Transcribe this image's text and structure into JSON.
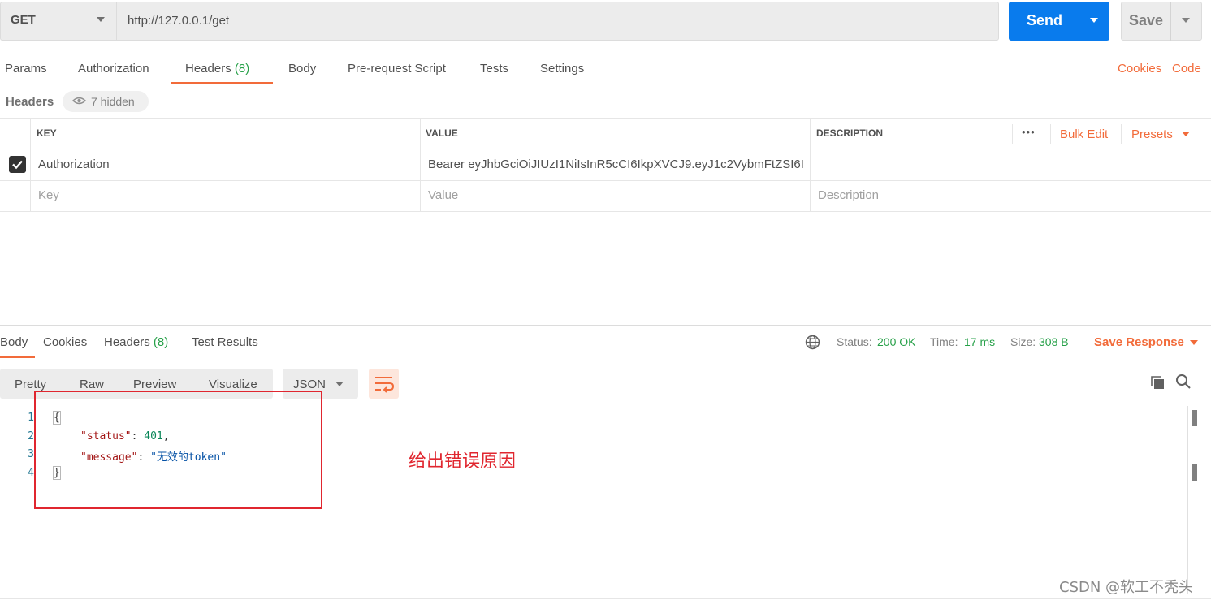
{
  "request": {
    "method": "GET",
    "url": "http://127.0.0.1/get",
    "send_label": "Send",
    "save_label": "Save"
  },
  "request_tabs": [
    {
      "label": "Params"
    },
    {
      "label": "Authorization"
    },
    {
      "label": "Headers",
      "count": "(8)",
      "active": true
    },
    {
      "label": "Body"
    },
    {
      "label": "Pre-request Script"
    },
    {
      "label": "Tests"
    },
    {
      "label": "Settings"
    }
  ],
  "right_links": {
    "cookies": "Cookies",
    "code": "Code"
  },
  "headers_section": {
    "title": "Headers",
    "hidden": "7 hidden",
    "columns": {
      "key": "KEY",
      "value": "VALUE",
      "description": "DESCRIPTION"
    },
    "more": "•••",
    "bulk_edit": "Bulk Edit",
    "presets": "Presets",
    "rows": [
      {
        "checked": true,
        "key": "Authorization",
        "value": "Bearer eyJhbGciOiJIUzI1NiIsInR5cCI6IkpXVCJ9.eyJ1c2VybmFtZSI6I…",
        "description": ""
      }
    ],
    "placeholders": {
      "key": "Key",
      "value": "Value",
      "description": "Description"
    }
  },
  "response": {
    "tabs": [
      {
        "label": "Body",
        "active": true
      },
      {
        "label": "Cookies"
      },
      {
        "label": "Headers",
        "count": "(8)"
      },
      {
        "label": "Test Results"
      }
    ],
    "status_label": "Status:",
    "status_value": "200 OK",
    "time_label": "Time:",
    "time_value": "17 ms",
    "size_label": "Size:",
    "size_value": "308 B",
    "save_response": "Save Response",
    "format_buttons": [
      "Pretty",
      "Raw",
      "Preview",
      "Visualize"
    ],
    "format_select": "JSON",
    "code_lines": [
      {
        "n": "1",
        "text": "{"
      },
      {
        "n": "2",
        "key": "\"status\"",
        "value": "401"
      },
      {
        "n": "3",
        "key": "\"message\"",
        "value": "\"无效的token\""
      },
      {
        "n": "4",
        "text": "}"
      }
    ]
  },
  "annotation": "给出错误原因",
  "watermark": "CSDN @软工不秃头",
  "colors": {
    "accent": "#f26b3a",
    "send_blue": "#097bed",
    "success_green": "#26a048",
    "annotation_red": "#e0262f"
  },
  "icons": [
    "chevron-down-icon",
    "eye-icon",
    "check-icon",
    "globe-icon",
    "wrap-lines-icon",
    "copy-icon",
    "search-icon"
  ]
}
